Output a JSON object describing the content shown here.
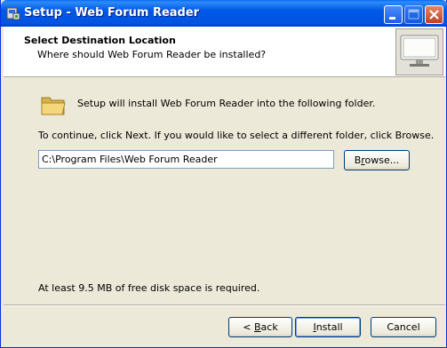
{
  "window": {
    "title": "Setup - Web Forum Reader"
  },
  "header": {
    "title": "Select Destination Location",
    "subtitle": "Where should Web Forum Reader be installed?"
  },
  "main": {
    "intro_text": "Setup will install Web Forum Reader into the following folder.",
    "instruction_text": "To continue, click Next. If you would like to select a different folder, click Browse.",
    "path_value": "C:\\Program Files\\Web Forum Reader",
    "browse_label_pre": "B",
    "browse_label_acc": "r",
    "browse_label_post": "owse...",
    "disk_space_text": "At least 9.5 MB of free disk space is required."
  },
  "footer": {
    "back_pre": "< ",
    "back_acc": "B",
    "back_post": "ack",
    "install_acc": "I",
    "install_post": "nstall",
    "cancel_label": "Cancel"
  },
  "icons": {
    "app": "setup-app-icon",
    "header": "monitor-icon",
    "folder": "folder-icon"
  },
  "colors": {
    "titlebar": "#0058e6",
    "face": "#ece9d8"
  }
}
